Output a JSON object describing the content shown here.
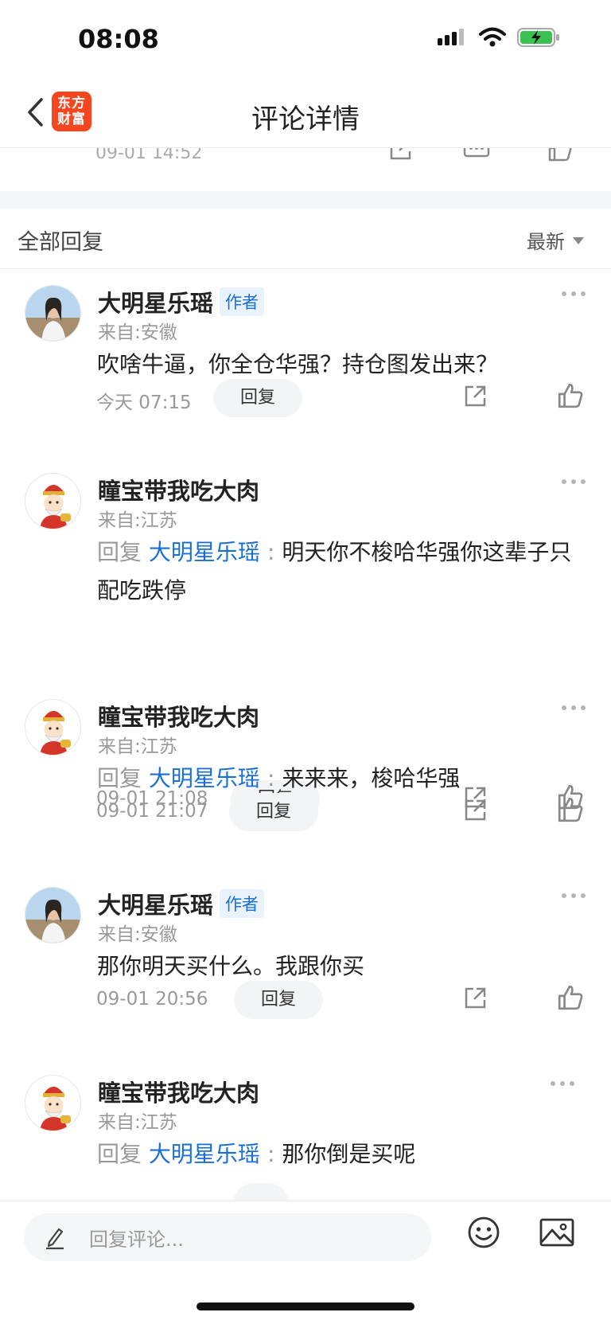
{
  "status_bar": {
    "time": "08:08",
    "icons": [
      "signal-icon",
      "wifi-icon",
      "battery-charging-icon"
    ]
  },
  "nav": {
    "back_icon": "chevron-left-icon",
    "logo_text": "东方财富",
    "title": "评论详情"
  },
  "previous": {
    "time": "09-01 14:52"
  },
  "section": {
    "title": "全部回复",
    "sort_label": "最新"
  },
  "labels": {
    "author_tag": "作者",
    "reply_button": "回复",
    "reply_prefix": "回复",
    "colon": ":"
  },
  "comments": [
    {
      "user": "大明星乐瑶",
      "is_author": true,
      "location": "来自:安徽",
      "is_reply": false,
      "reply_to": "",
      "text": "吹啥牛逼，你全仓华强？持仓图发出来？",
      "time": "今天 07:15"
    },
    {
      "user": "瞳宝带我吃大肉",
      "is_author": false,
      "location": "来自:江苏",
      "is_reply": true,
      "reply_to": "大明星乐瑶",
      "text": "明天你不梭哈华强你这辈子只配吃跌停",
      "time": "09-01 21:08"
    },
    {
      "user": "瞳宝带我吃大肉",
      "is_author": false,
      "location": "来自:江苏",
      "is_reply": true,
      "reply_to": "大明星乐瑶",
      "text": "来来来，梭哈华强",
      "time": "09-01 21:07"
    },
    {
      "user": "大明星乐瑶",
      "is_author": true,
      "location": "来自:安徽",
      "is_reply": false,
      "reply_to": "",
      "text": "那你明天买什么。我跟你买",
      "time": "09-01 20:56"
    },
    {
      "user": "瞳宝带我吃大肉",
      "is_author": false,
      "location": "来自:江苏",
      "is_reply": true,
      "reply_to": "大明星乐瑶",
      "text": "那你倒是买呢",
      "time": ""
    }
  ],
  "input": {
    "placeholder": "回复评论..."
  },
  "colors": {
    "accent_blue": "#1a6fd6",
    "brand_orange": "#f5461f",
    "muted_text": "#999999"
  }
}
